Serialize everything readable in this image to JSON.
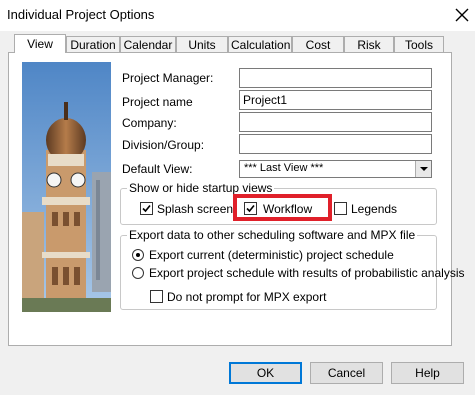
{
  "window": {
    "title": "Individual Project Options",
    "close_icon": "close-icon"
  },
  "tabs": [
    {
      "label": "View",
      "active": true
    },
    {
      "label": "Duration"
    },
    {
      "label": "Calendar"
    },
    {
      "label": "Units"
    },
    {
      "label": "Calculation"
    },
    {
      "label": "Cost"
    },
    {
      "label": "Risk"
    },
    {
      "label": "Tools"
    }
  ],
  "form": {
    "project_manager": {
      "label": "Project Manager:",
      "value": ""
    },
    "project_name": {
      "label": "Project name",
      "value": "Project1"
    },
    "company": {
      "label": "Company:",
      "value": ""
    },
    "division": {
      "label": "Division/Group:",
      "value": ""
    },
    "default_view": {
      "label": "Default View:",
      "value": "*** Last View ***"
    }
  },
  "startup_views": {
    "legend": "Show or hide startup views",
    "splash": {
      "label": "Splash screen",
      "checked": true
    },
    "workflow": {
      "label": "Workflow",
      "checked": true
    },
    "legends": {
      "label": "Legends",
      "checked": false
    }
  },
  "export": {
    "legend": "Export data to other scheduling software and MPX file",
    "option1": {
      "label": "Export current (deterministic) project schedule",
      "selected": true
    },
    "option2": {
      "label": "Export project schedule with results of probabilistic analysis",
      "selected": false
    },
    "no_prompt": {
      "label": "Do not prompt for MPX export",
      "checked": false
    }
  },
  "buttons": {
    "ok": "OK",
    "cancel": "Cancel",
    "help": "Help"
  },
  "colors": {
    "highlight": "#e0202a",
    "dialog_bg": "#f0f0f0",
    "focus": "#0078d7"
  }
}
